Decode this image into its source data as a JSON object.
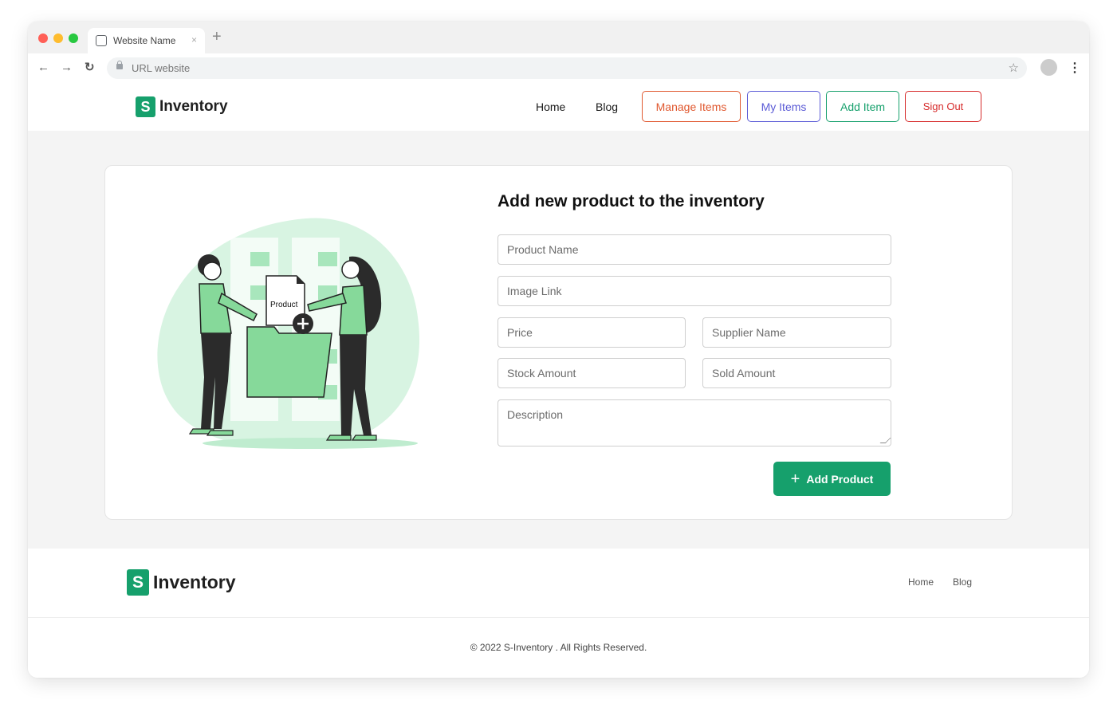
{
  "browser": {
    "tab_title": "Website Name",
    "tab_close": "×",
    "new_tab": "+",
    "url": "URL website",
    "traffic_lights": [
      "#ff5f57",
      "#febc2e",
      "#28c840"
    ]
  },
  "header": {
    "logo_letter": "S",
    "logo_text": "Inventory",
    "nav": {
      "home": "Home",
      "blog": "Blog"
    },
    "buttons": {
      "manage_items": "Manage Items",
      "my_items": "My Items",
      "add_item": "Add Item",
      "sign_out": "Sign Out"
    }
  },
  "form": {
    "title": "Add new product to the inventory",
    "product_name_placeholder": "Product Name",
    "image_link_placeholder": "Image Link",
    "price_placeholder": "Price",
    "supplier_name_placeholder": "Supplier Name",
    "stock_amount_placeholder": "Stock Amount",
    "sold_amount_placeholder": "Sold Amount",
    "description_placeholder": "Description",
    "submit_label": "Add Product"
  },
  "illustration": {
    "label": "Product"
  },
  "footer": {
    "logo_letter": "S",
    "logo_text": "Inventory",
    "links": {
      "home": "Home",
      "blog": "Blog"
    },
    "copyright": "© 2022 S-Inventory . All Rights Reserved."
  },
  "colors": {
    "brand_green": "#16a06c",
    "manage_border": "#e0582f",
    "my_items_border": "#5b5bd6",
    "add_item_border": "#16a06c",
    "sign_out_border": "#d62a2a"
  }
}
